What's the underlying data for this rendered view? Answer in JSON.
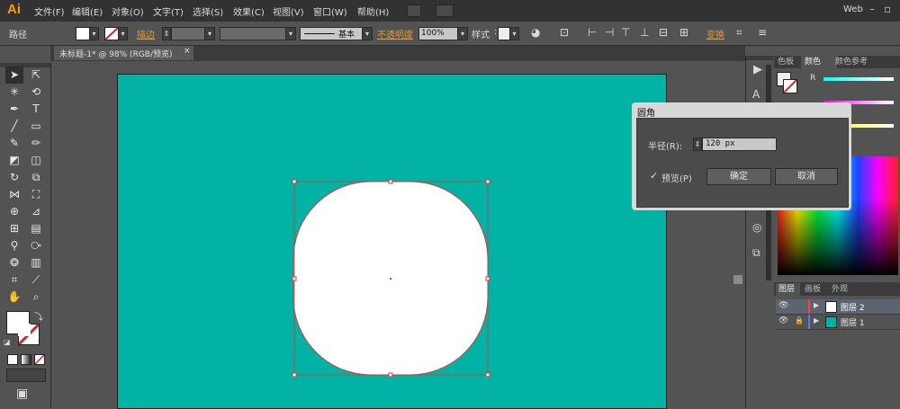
{
  "app": {
    "logo": "Ai",
    "workspace": "Web"
  },
  "menu": [
    "文件(F)",
    "编辑(E)",
    "对象(O)",
    "文字(T)",
    "选择(S)",
    "效果(C)",
    "视图(V)",
    "窗口(W)",
    "帮助(H)"
  ],
  "control_bar": {
    "selection_label": "路径",
    "stroke_label": "描边",
    "stroke_style": "基本",
    "opacity_label": "不透明度",
    "opacity_value": "100%",
    "style_label": "样式",
    "transform_label": "变换"
  },
  "document_tab": {
    "title": "未标题-1* @ 98% (RGB/预览)",
    "close": "×"
  },
  "color_panel": {
    "tabs": [
      "色板",
      "颜色",
      "颜色参考"
    ],
    "channel_r": "R"
  },
  "layers_panel": {
    "tabs": [
      "图层",
      "画板",
      "外观"
    ],
    "layers": [
      {
        "name": "图层 2",
        "color": "#ff4040"
      },
      {
        "name": "图层 1",
        "color": "#4f7cff"
      }
    ]
  },
  "dialog": {
    "title": "圆角",
    "radius_label": "半径(R):",
    "radius_value": "120 px",
    "preview_label": "预览(P)",
    "preview_checked": true,
    "ok_label": "确定",
    "cancel_label": "取消"
  },
  "colors": {
    "artboard": "#02b2a5",
    "shape": "#ffffff",
    "selection": "#d23c3c",
    "accent": "#ff9a00"
  }
}
